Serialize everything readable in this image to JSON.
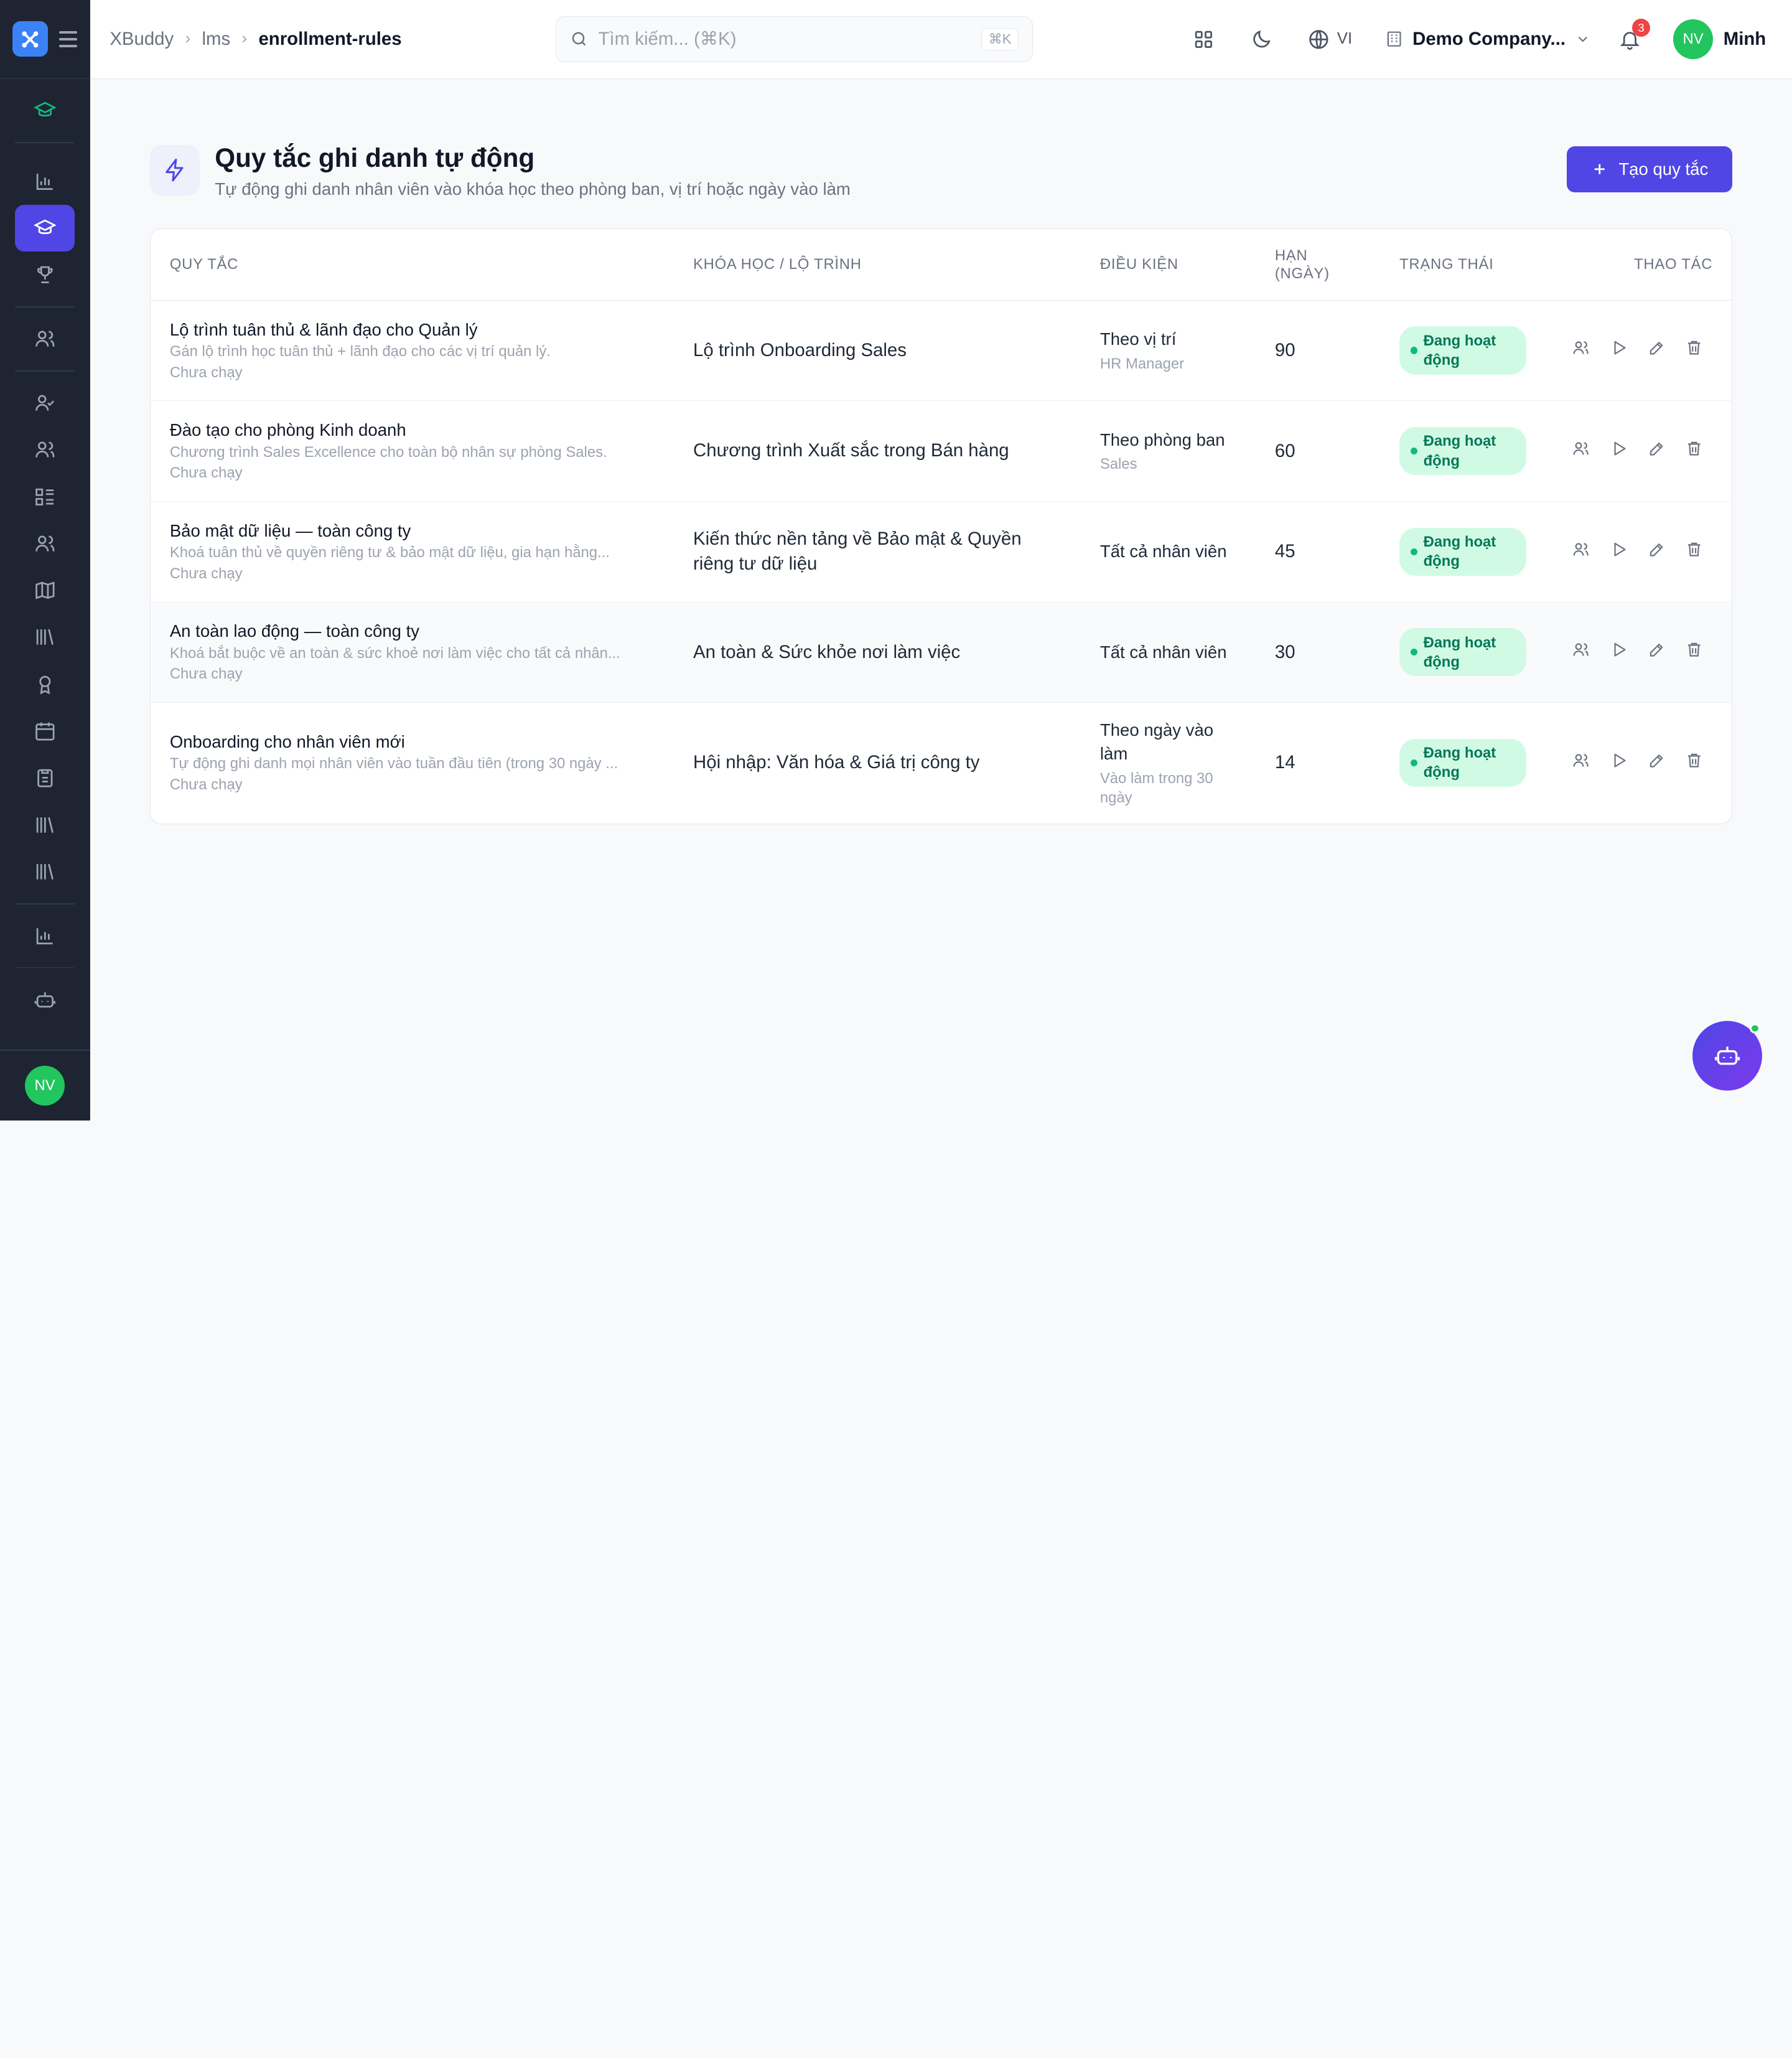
{
  "app": {
    "logo_icon": "close-icon"
  },
  "breadcrumb": {
    "root": "XBuddy",
    "mid": "lms",
    "current": "enrollment-rules"
  },
  "search": {
    "placeholder": "Tìm kiếm... (⌘K)",
    "shortcut": "⌘K"
  },
  "topbar": {
    "language": "VI",
    "company": "Demo Company...",
    "notifications": "3",
    "user_initials": "NV",
    "user_name": "Minh"
  },
  "page": {
    "title": "Quy tắc ghi danh tự động",
    "subtitle": "Tự động ghi danh nhân viên vào khóa học theo phòng ban, vị trí hoặc ngày vào làm",
    "create_label": "Tạo quy tắc"
  },
  "table": {
    "headers": {
      "rule": "QUY TẮC",
      "course": "KHÓA HỌC / LỘ TRÌNH",
      "condition": "ĐIỀU KIỆN",
      "days": "HẠN (NGÀY)",
      "status": "TRẠNG THÁI",
      "actions": "THAO TÁC"
    },
    "rows": [
      {
        "title": "Lộ trình tuân thủ & lãnh đạo cho Quản lý",
        "desc": "Gán lộ trình học tuân thủ + lãnh đạo cho các vị trí quản lý.",
        "run": "Chưa chạy",
        "course": "Lộ trình Onboarding Sales",
        "cond": "Theo vị trí",
        "cond_sub": "HR Manager",
        "days": "90",
        "status": "Đang hoạt động"
      },
      {
        "title": "Đào tạo cho phòng Kinh doanh",
        "desc": "Chương trình Sales Excellence cho toàn bộ nhân sự phòng Sales.",
        "run": "Chưa chạy",
        "course": "Chương trình Xuất sắc trong Bán hàng",
        "cond": "Theo phòng ban",
        "cond_sub": "Sales",
        "days": "60",
        "status": "Đang hoạt động"
      },
      {
        "title": "Bảo mật dữ liệu — toàn công ty",
        "desc": "Khoá tuân thủ về quyền riêng tư & bảo mật dữ liệu, gia hạn hằng...",
        "run": "Chưa chạy",
        "course": "Kiến thức nền tảng về Bảo mật & Quyền riêng tư dữ liệu",
        "cond": "Tất cả nhân viên",
        "cond_sub": "",
        "days": "45",
        "status": "Đang hoạt động"
      },
      {
        "title": "An toàn lao động — toàn công ty",
        "desc": "Khoá bắt buộc về an toàn & sức khoẻ nơi làm việc cho tất cả nhân...",
        "run": "Chưa chạy",
        "course": "An toàn & Sức khỏe nơi làm việc",
        "cond": "Tất cả nhân viên",
        "cond_sub": "",
        "days": "30",
        "status": "Đang hoạt động"
      },
      {
        "title": "Onboarding cho nhân viên mới",
        "desc": "Tự động ghi danh mọi nhân viên vào tuần đầu tiên (trong 30 ngày ...",
        "run": "Chưa chạy",
        "course": "Hội nhập: Văn hóa & Giá trị công ty",
        "cond": "Theo ngày vào làm",
        "cond_sub": "Vào làm trong 30 ngày",
        "days": "14",
        "status": "Đang hoạt động"
      }
    ]
  },
  "colors": {
    "primary": "#4f46e5",
    "sidebar": "#1e2431",
    "status_bg": "#d1fae5",
    "status_text": "#047857"
  }
}
